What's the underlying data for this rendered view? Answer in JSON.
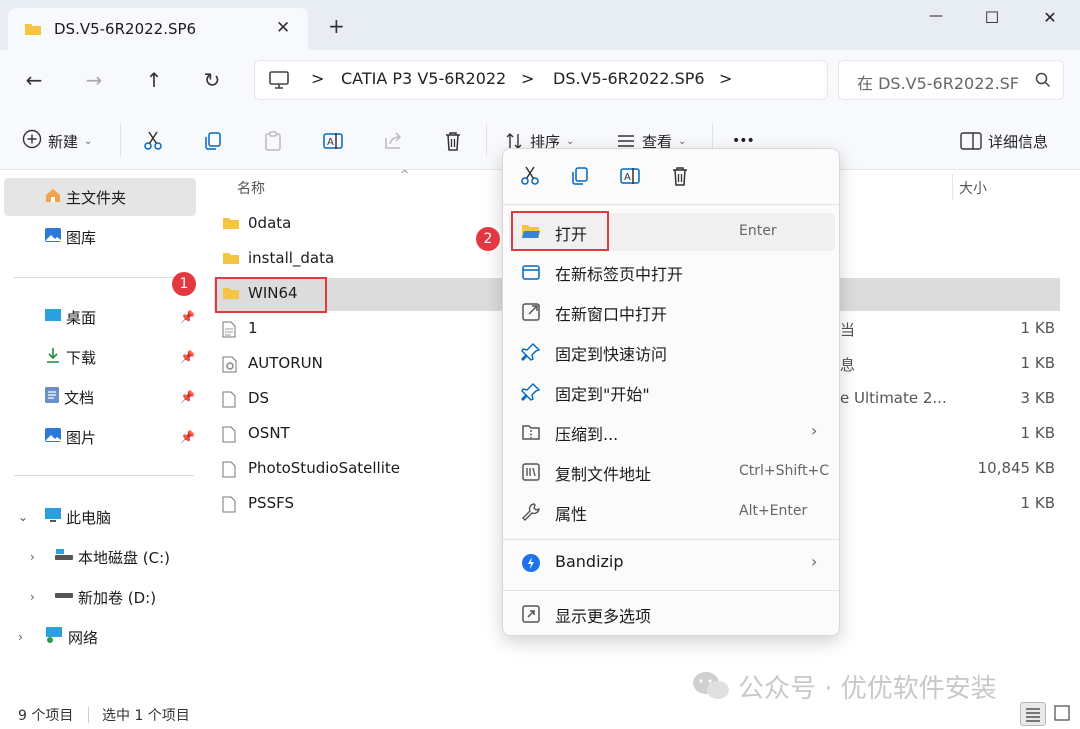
{
  "tab": {
    "title": "DS.V5-6R2022.SP6",
    "close": "✕",
    "new_tab": "+"
  },
  "window": {
    "minimize": "—",
    "maximize": "☐",
    "close": "✕"
  },
  "nav": {
    "back": "←",
    "forward": "→",
    "up": "↑",
    "refresh": "↻"
  },
  "address": {
    "crumbs": [
      "CATIA P3 V5-6R2022",
      "DS.V5-6R2022.SP6"
    ],
    "separator": ">",
    "search_placeholder": "在 DS.V5-6R2022.SF"
  },
  "toolbar": {
    "new_label": "新建",
    "sort_label": "排序",
    "view_label": "查看",
    "more_label": "•••",
    "details_label": "详细信息"
  },
  "sidebar": {
    "home": "主文件夹",
    "gallery": "图库",
    "quick": [
      "桌面",
      "下载",
      "文档",
      "图片"
    ],
    "pin": "📌",
    "this_pc": "此电脑",
    "drives": [
      "本地磁盘 (C:)",
      "新加卷 (D:)"
    ],
    "network": "网络"
  },
  "columns": {
    "name": "名称",
    "size": "大小"
  },
  "files": [
    {
      "name": "0data",
      "kind": "folder",
      "type": "",
      "size": ""
    },
    {
      "name": "install_data",
      "kind": "folder",
      "type": "",
      "size": ""
    },
    {
      "name": "WIN64",
      "kind": "folder",
      "type": "",
      "size": ""
    },
    {
      "name": "1",
      "kind": "text",
      "type": "当",
      "size": "1 KB"
    },
    {
      "name": "AUTORUN",
      "kind": "setup",
      "type": "息",
      "size": "1 KB"
    },
    {
      "name": "DS",
      "kind": "file",
      "type": "e Ultimate 2...",
      "size": "3 KB"
    },
    {
      "name": "OSNT",
      "kind": "file",
      "type": "",
      "size": "1 KB"
    },
    {
      "name": "PhotoStudioSatellite",
      "kind": "file",
      "type": "",
      "size": "10,845 KB"
    },
    {
      "name": "PSSFS",
      "kind": "file",
      "type": "",
      "size": "1 KB"
    }
  ],
  "annotations": {
    "step1": "1",
    "step2": "2"
  },
  "context_menu": {
    "items": [
      {
        "label": "打开",
        "shortcut": "Enter",
        "icon": "open-folder-icon"
      },
      {
        "label": "在新标签页中打开",
        "shortcut": "",
        "icon": "new-tab-icon"
      },
      {
        "label": "在新窗口中打开",
        "shortcut": "",
        "icon": "new-window-icon"
      },
      {
        "label": "固定到快速访问",
        "shortcut": "",
        "icon": "pin-icon"
      },
      {
        "label": "固定到\"开始\"",
        "shortcut": "",
        "icon": "pin-start-icon"
      },
      {
        "label": "压缩到...",
        "shortcut": "",
        "icon": "zip-icon",
        "submenu": true
      },
      {
        "label": "复制文件地址",
        "shortcut": "Ctrl+Shift+C",
        "icon": "copy-path-icon"
      },
      {
        "label": "属性",
        "shortcut": "Alt+Enter",
        "icon": "wrench-icon"
      },
      {
        "label": "Bandizip",
        "shortcut": "",
        "icon": "bandizip-icon",
        "submenu": true
      },
      {
        "label": "显示更多选项",
        "shortcut": "",
        "icon": "more-options-icon"
      }
    ],
    "submenu_arrow": "›"
  },
  "status": {
    "count": "9 个项目",
    "selected": "选中 1 个项目"
  },
  "watermark": {
    "text": "公众号 · 优优软件安装"
  },
  "colors": {
    "accent": "#0067c0",
    "annotation_red": "#e2383f",
    "folder_yellow": "#f5c542"
  }
}
